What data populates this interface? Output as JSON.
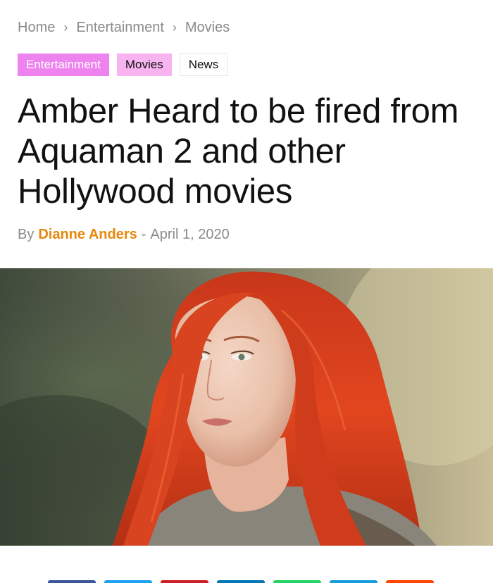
{
  "breadcrumb": {
    "items": [
      "Home",
      "Entertainment",
      "Movies"
    ]
  },
  "tags": [
    {
      "label": "Entertainment",
      "color": "#ee82ee"
    },
    {
      "label": "Movies",
      "color": "#f7b4f0"
    },
    {
      "label": "News",
      "color": "#ffffff"
    }
  ],
  "article": {
    "title": "Amber Heard to be fired from Aquaman 2 and other Hollywood movies",
    "byline_prefix": "By",
    "author": "Dianne Anders",
    "separator": "-",
    "date": "April 1, 2020",
    "author_color": "#e8870b"
  },
  "hero_image": {
    "subject": "woman-with-red-hair-portrait-icon"
  },
  "share_buttons": [
    {
      "name": "facebook-share-icon",
      "color": "#3b5998"
    },
    {
      "name": "twitter-share-icon",
      "color": "#1da1f2"
    },
    {
      "name": "pinterest-share-icon",
      "color": "#cb2027"
    },
    {
      "name": "linkedin-share-icon",
      "color": "#0077b5"
    },
    {
      "name": "whatsapp-share-icon",
      "color": "#25d366"
    },
    {
      "name": "telegram-share-icon",
      "color": "#179cde"
    },
    {
      "name": "reddit-share-icon",
      "color": "#ff4500"
    }
  ]
}
